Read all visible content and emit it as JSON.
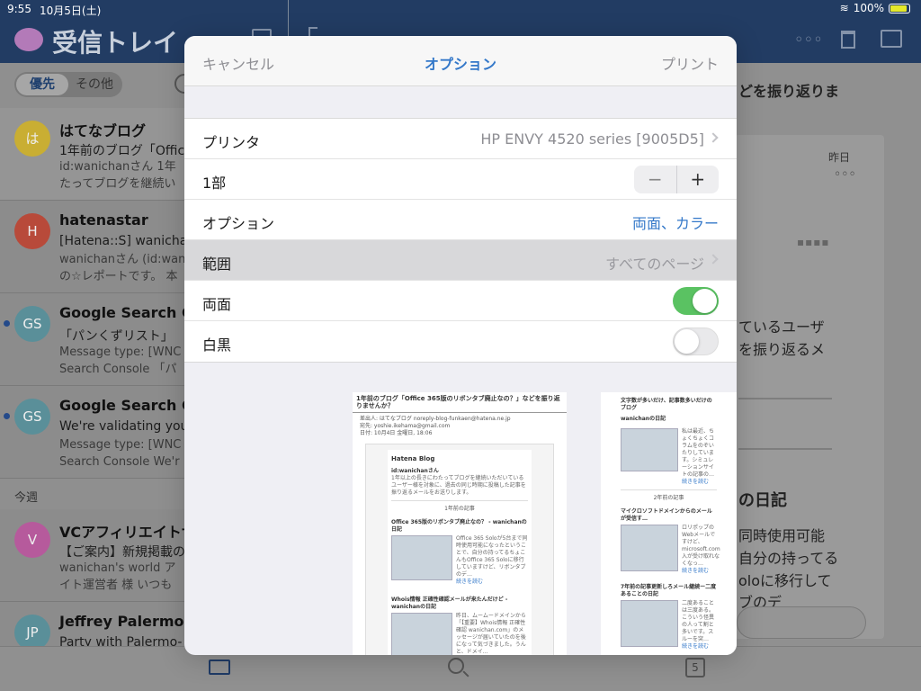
{
  "status": {
    "time": "9:55",
    "date": "10月5日(土)",
    "battery": "100%"
  },
  "inbox": {
    "title": "受信トレイ",
    "tabs": [
      {
        "label": "優先"
      },
      {
        "label": "その他"
      }
    ],
    "section_this_week": "今週",
    "mails": [
      {
        "avatar": "は",
        "color": "#c9ae33",
        "sender": "はてなブログ",
        "subject": "1年前のブログ「Offic",
        "preview1": "id:wanichanさん 1年",
        "preview2": "たってブログを継続い",
        "unread": false
      },
      {
        "avatar": "H",
        "color": "#b84a3a",
        "sender": "hatenastar",
        "subject": "[Hatena::S] wanichan",
        "preview1": "wanichanさん (id:wan",
        "preview2": "の☆レポートです。 本",
        "unread": false
      },
      {
        "avatar": "GS",
        "color": "#5a8f99",
        "sender": "Google Search Co",
        "subject": "「パンくずリスト」",
        "preview1": "Message type: [WNC",
        "preview2": "Search Console 「パ",
        "unread": true
      },
      {
        "avatar": "GS",
        "color": "#5a8f99",
        "sender": "Google Search Co",
        "subject": "We're validating your",
        "preview1": "Message type: [WNC",
        "preview2": "Search Console We'r",
        "unread": true
      },
      {
        "avatar": "V",
        "color": "#b65a9c",
        "sender": "VCアフィリエイトサ",
        "subject": "【ご案内】新規掲載の",
        "preview1": "wanichan's world ア",
        "preview2": "イト運営者 様 いつも",
        "unread": false
      },
      {
        "avatar": "JP",
        "color": "#5a8f99",
        "sender": "Jeffrey Palermo",
        "subject": "Party with Palermo-",
        "preview1": "",
        "preview2": "",
        "unread": false
      }
    ]
  },
  "reading": {
    "subject": "どを振り返りま",
    "yesterday": "昨日",
    "more": "◦◦◦",
    "text1": "ているユーザ",
    "text2": "を振り返るメ",
    "heading": "の日記",
    "text3": "同時使用可能",
    "text4": "自分の持ってる",
    "text5": "oloに移行して",
    "text6": "ブのデ"
  },
  "tabbar": {
    "calendar_day": "5"
  },
  "dialog": {
    "cancel": "キャンセル",
    "title": "オプション",
    "print": "プリント",
    "printer_label": "プリンタ",
    "printer_value": "HP ENVY 4520 series [9005D5]",
    "copies_label": "1部",
    "stepper_minus": "−",
    "stepper_plus": "+",
    "options_label": "オプション",
    "options_value": "両面、カラー",
    "range_label": "範囲",
    "range_value": "すべてのページ",
    "duplex_label": "両面",
    "bw_label": "白黒"
  },
  "preview1": {
    "header": "1年前のブログ「Office 365版のリボンタブ廃止なの？」などを振り返りませんか？",
    "from": "差出人: はてなブログ noreply-blog-funkaen@hatena.ne.jp",
    "to": "宛先: yoshie.ikehama@gmail.com",
    "date": "日付: 10月4日 金曜日, 18:06",
    "logo": "Hatena Blog",
    "user": "id:wanichanさん",
    "intro": "1年以上の長きにわたってブログを継続いただいているユーザー様を対象に、過去の同じ時期に投稿した記事を振り返るメールをお送りします。",
    "section": "1年前の記事",
    "art1_title": "Office 365版のリボンタブ廃止なの？ - wanichanの日記",
    "art1_body": "Office 365 Soloが5台まで同時使用可能になったということで、自分の持ってるちょこんもOffice 365 Soloに移行していますけど、リボンタブのデ…",
    "read_more": "続きを読む",
    "art2_title": "Whois情報 正確性確認メールが来たんだけど - wanichanの日記",
    "art2_body": "昨日、ムームードメインから「【重要】Whois情報 正確性確認 wanichan.com」のメッセージが届いていたのを後になって気づきました。うんと、ドメイ…"
  },
  "preview2": {
    "top": "文字数が多いだけ、記事数多いだけのブログ",
    "top2": "wanichanの日記",
    "body1": "私は最近、ちょくちょくコラムをのぞいたりしています。シミュレーションサイトの記事の…",
    "read_more": "続きを読む",
    "section": "2年前の記事",
    "art1_title": "マイクロソフトドメインからのメールが受信す…",
    "art1_body": "ロリポップのWebメールですけど、microsoft.com 入が受け取れなくなっ…",
    "art2_title": "7年前の記事更新しろメール継続ー二度あることの日記",
    "art2_body": "二度あることは三度ある。こういう怪異の人って割と多いです。スルーを突…"
  }
}
